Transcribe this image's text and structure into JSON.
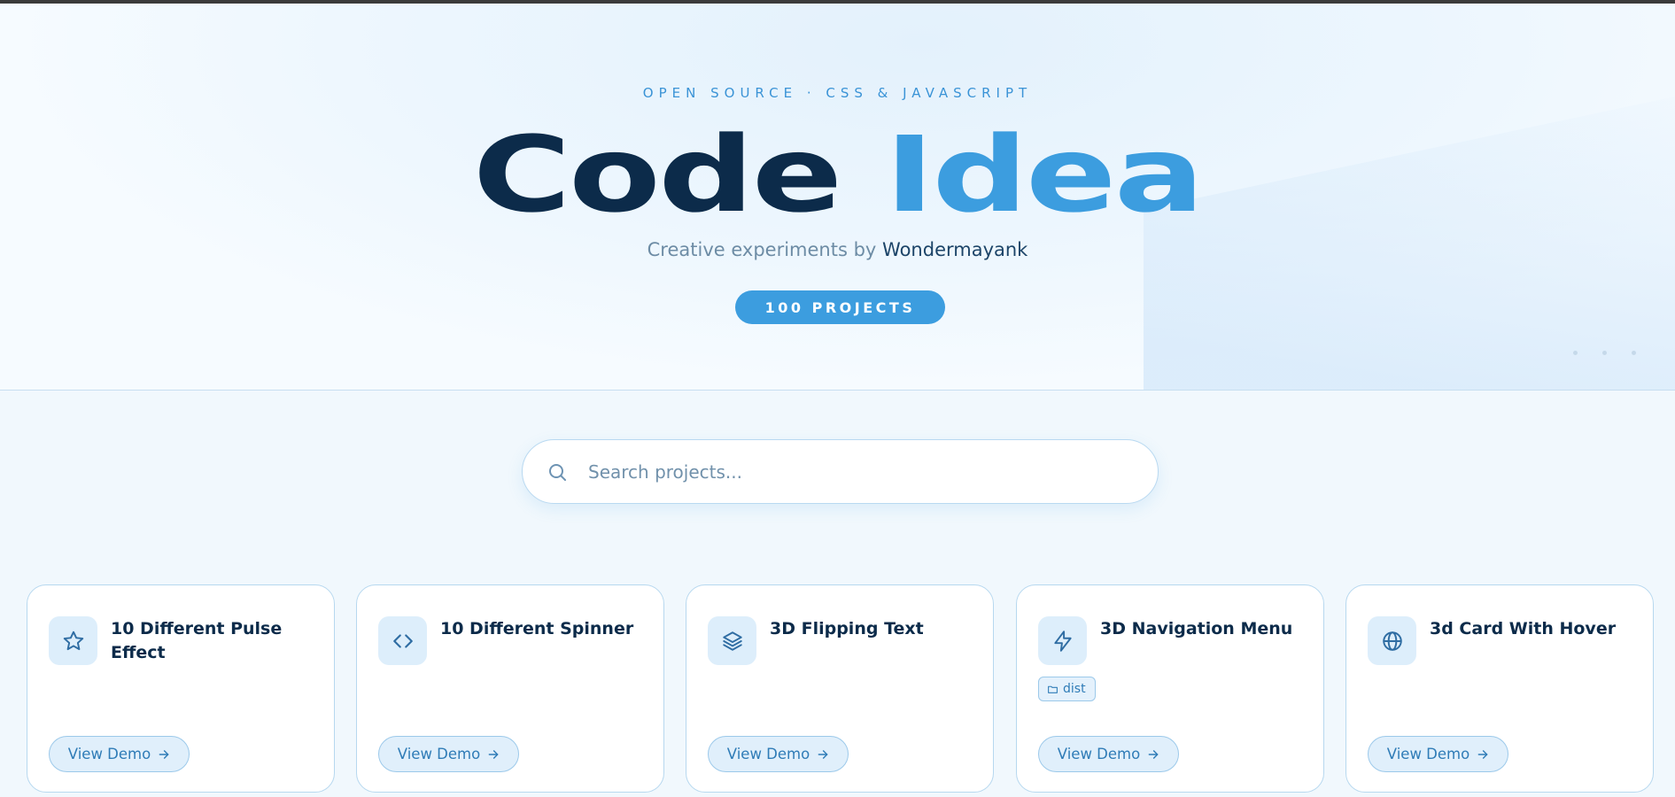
{
  "hero": {
    "eyebrow": "OPEN SOURCE · CSS & JAVASCRIPT",
    "title_part1": "Code",
    "title_part2": "Idea",
    "subtitle_prefix": "Creative experiments by",
    "author": "Wondermayank",
    "project_count_badge": "100 PROJECTS"
  },
  "search": {
    "placeholder": "Search projects...",
    "value": "",
    "icon": "search-icon"
  },
  "projects": [
    {
      "title": "10 Different Pulse Effect",
      "icon": "star-icon",
      "tag": "",
      "button_label": "View Demo"
    },
    {
      "title": "10 Different Spinner",
      "icon": "code-icon",
      "tag": "",
      "button_label": "View Demo"
    },
    {
      "title": "3D Flipping Text",
      "icon": "layers-icon",
      "tag": "",
      "button_label": "View Demo"
    },
    {
      "title": "3D Navigation Menu",
      "icon": "lightning-icon",
      "tag": "dist",
      "button_label": "View Demo"
    },
    {
      "title": "3d Card With Hover",
      "icon": "globe-icon",
      "tag": "",
      "button_label": "View Demo"
    }
  ],
  "colors": {
    "accent": "#3c9ddf",
    "title_dark": "#0c2b4a",
    "page_bg": "#f1f8fd"
  }
}
